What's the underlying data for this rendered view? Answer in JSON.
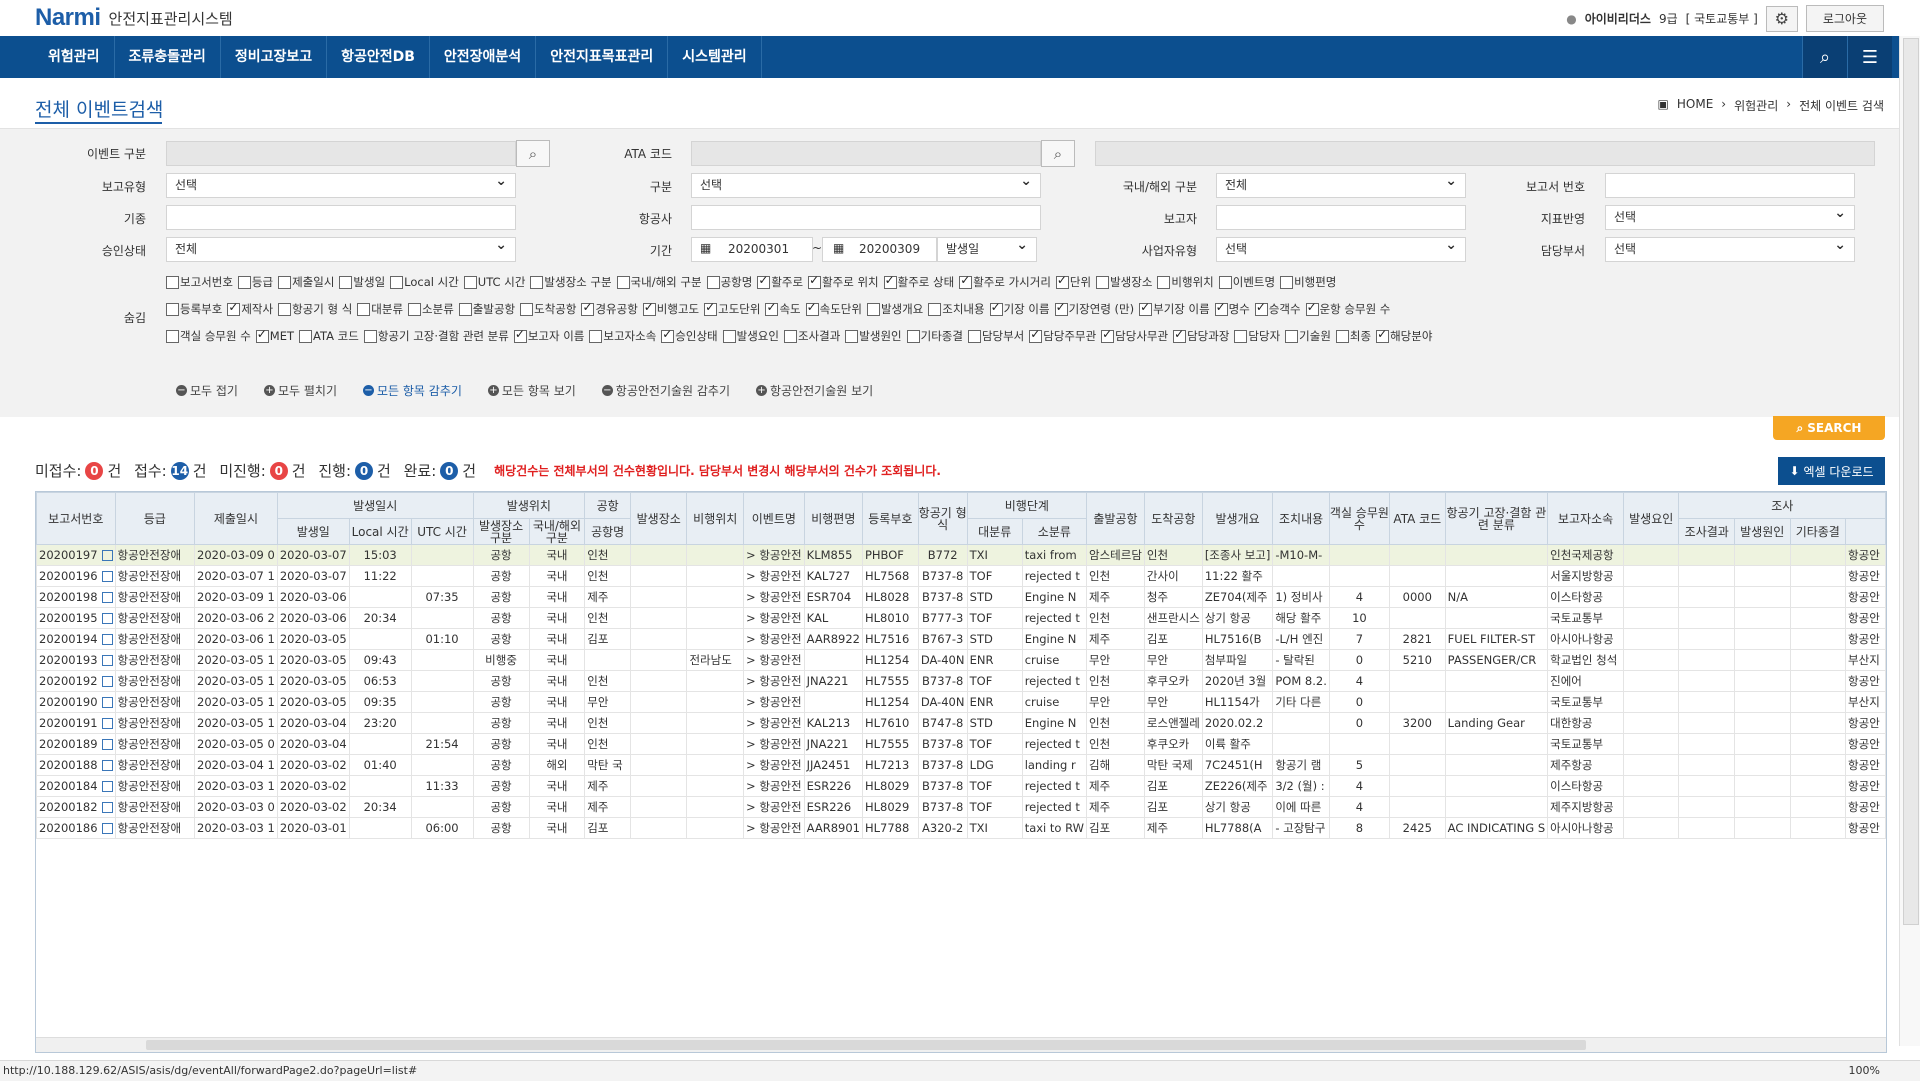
{
  "app": {
    "logo_main": "Narmi",
    "logo_accent": "",
    "system_name": "안전지표관리시스템",
    "user_name": "아이비리더스",
    "user_grade": "9급",
    "user_org": "[ 국토교통부 ]",
    "logout_label": "로그아웃"
  },
  "nav": [
    "위험관리",
    "조류충돌관리",
    "정비고장보고",
    "항공안전DB",
    "안전장애분석",
    "안전지표목표관리",
    "시스템관리"
  ],
  "page": {
    "title": "전체 이벤트검색",
    "breadcrumb": [
      "HOME",
      "위험관리",
      "전체 이벤트 검색"
    ]
  },
  "form": {
    "event_type_label": "이벤트 구분",
    "ata_label": "ATA 코드",
    "report_type_label": "보고유형",
    "report_type_value": "선택",
    "category_label": "구분",
    "category_value": "선택",
    "domestic_label": "국내/해외 구분",
    "domestic_value": "전체",
    "report_no_label": "보고서 번호",
    "aircraft_type_label": "기종",
    "airline_label": "항공사",
    "reporter_label": "보고자",
    "indicator_label": "지표반영",
    "indicator_value": "선택",
    "approval_label": "승인상태",
    "approval_value": "전체",
    "period_label": "기간",
    "period_from": "20200301",
    "period_tilde": "~",
    "period_to": "20200309",
    "period_type": "발생일",
    "cause_type_label": "사업자유형",
    "cause_type_value": "선택",
    "dept_label": "담당부서",
    "dept_value": "선택",
    "hide_label": "숨김"
  },
  "hide_rows": [
    [
      {
        "label": "보고서번호",
        "checked": false
      },
      {
        "label": "등급",
        "checked": false
      },
      {
        "label": "제출일시",
        "checked": false
      },
      {
        "label": "발생일",
        "checked": false
      },
      {
        "label": "Local 시간",
        "checked": false
      },
      {
        "label": "UTC 시간",
        "checked": false
      },
      {
        "label": "발생장소 구분",
        "checked": false
      },
      {
        "label": "국내/해외 구분",
        "checked": false
      },
      {
        "label": "공항명",
        "checked": false
      },
      {
        "label": "활주로",
        "checked": true
      },
      {
        "label": "활주로 위치",
        "checked": true
      },
      {
        "label": "활주로 상태",
        "checked": true
      },
      {
        "label": "활주로 가시거리",
        "checked": true
      },
      {
        "label": "단위",
        "checked": true
      },
      {
        "label": "발생장소",
        "checked": false
      },
      {
        "label": "비행위치",
        "checked": false
      },
      {
        "label": "이벤트명",
        "checked": false
      },
      {
        "label": "비행편명",
        "checked": false
      }
    ],
    [
      {
        "label": "등록부호",
        "checked": false
      },
      {
        "label": "제작사",
        "checked": true
      },
      {
        "label": "항공기 형 식",
        "checked": false
      },
      {
        "label": "대분류",
        "checked": false
      },
      {
        "label": "소분류",
        "checked": false
      },
      {
        "label": "출발공항",
        "checked": false
      },
      {
        "label": "도착공항",
        "checked": false
      },
      {
        "label": "경유공항",
        "checked": true
      },
      {
        "label": "비행고도",
        "checked": true
      },
      {
        "label": "고도단위",
        "checked": true
      },
      {
        "label": "속도",
        "checked": true
      },
      {
        "label": "속도단위",
        "checked": true
      },
      {
        "label": "발생개요",
        "checked": false
      },
      {
        "label": "조치내용",
        "checked": false
      },
      {
        "label": "기장 이름",
        "checked": true
      },
      {
        "label": "기장연령 (만)",
        "checked": true
      },
      {
        "label": "부기장 이름",
        "checked": true
      },
      {
        "label": "명수",
        "checked": true
      },
      {
        "label": "승객수",
        "checked": true
      },
      {
        "label": "운항 승무원 수",
        "checked": true
      }
    ],
    [
      {
        "label": "객실 승무원 수",
        "checked": false
      },
      {
        "label": "MET",
        "checked": true
      },
      {
        "label": "ATA 코드",
        "checked": false
      },
      {
        "label": "항공기 고장·결함 관련 분류",
        "checked": false
      },
      {
        "label": "보고자 이름",
        "checked": true
      },
      {
        "label": "보고자소속",
        "checked": false
      },
      {
        "label": "승인상태",
        "checked": true
      },
      {
        "label": "발생요인",
        "checked": false
      },
      {
        "label": "조사결과",
        "checked": false
      },
      {
        "label": "발생원인",
        "checked": false
      },
      {
        "label": "기타종결",
        "checked": false
      },
      {
        "label": "담당부서",
        "checked": false
      },
      {
        "label": "담당주무관",
        "checked": true
      },
      {
        "label": "담당사무관",
        "checked": true
      },
      {
        "label": "담당과장",
        "checked": true
      },
      {
        "label": "담당자",
        "checked": false
      },
      {
        "label": "기술원",
        "checked": false
      },
      {
        "label": "최종",
        "checked": false
      },
      {
        "label": "해당분야",
        "checked": true
      }
    ]
  ],
  "controls": [
    "모두 접기",
    "모두 펼치기",
    "모든 항목 감추기",
    "모든 항목 보기",
    "항공안전기술원 감추기",
    "항공안전기술원 보기"
  ],
  "search_label": "SEARCH",
  "summary": {
    "pending_label": "미접수:",
    "pending": "0",
    "unit": "건",
    "received_label": "접수:",
    "received": "14",
    "notdone_label": "미진행:",
    "notdone": "0",
    "progress_label": "진행:",
    "progress": "0",
    "done_label": "완료:",
    "done": "0",
    "notice": "해당건수는 전체부서의 건수현황입니다. 담당부서 변경시 해당부서의 건수가 조회됩니다."
  },
  "excel_label": "엑셀 다운로드",
  "table": {
    "groups": {
      "occur_datetime": "발생일시",
      "occur_pos": "발생위치",
      "airport": "공항",
      "flight_phase": "비행단계",
      "investigation": "조사"
    },
    "headers": {
      "report_no": "보고서번호",
      "grade": "등급",
      "submitted": "제출일시",
      "occur_date": "발생일",
      "local": "Local 시간",
      "utc": "UTC 시간",
      "pos_type": "발생장소 구분",
      "dom": "국내/해외 구분",
      "airport_name": "공항명",
      "place": "발생장소",
      "flight_pos": "비행위치",
      "event": "이벤트명",
      "flight_no": "비행편명",
      "reg": "등록부호",
      "ac_type": "항공기 형 식",
      "major": "대분류",
      "minor": "소분류",
      "dep": "출발공항",
      "arr": "도착공항",
      "summary": "발생개요",
      "action": "조치내용",
      "cabin": "객실 승무원 수",
      "ata": "ATA 코드",
      "defect": "항공기 고장·결함 관련 분류",
      "reporter_org": "보고자소속",
      "factor": "발생요인",
      "result": "조사결과",
      "cause": "발생원인",
      "other": "기타종결"
    },
    "rows": [
      [
        "20200197",
        "항공안전장애",
        "2020-03-09 0",
        "2020-03-07",
        "15:03",
        "",
        "공항",
        "국내",
        "인천",
        "",
        "",
        "> 항공안전",
        "KLM855",
        "PHBOF",
        "B772",
        "TXI",
        "taxi from",
        "암스테르담",
        "인천",
        "[조종사 보고]",
        "-M10-M-",
        "",
        "",
        "",
        "인천국제공항",
        "",
        "",
        "",
        "",
        "항공안"
      ],
      [
        "20200196",
        "항공안전장애",
        "2020-03-07 1",
        "2020-03-07",
        "11:22",
        "",
        "공항",
        "국내",
        "인천",
        "",
        "",
        "> 항공안전",
        "KAL727",
        "HL7568",
        "B737-8",
        "TOF",
        "rejected t",
        "인천",
        "간사이",
        "11:22 활주",
        "",
        "",
        "",
        "",
        "서울지방항공",
        "",
        "",
        "",
        "",
        "항공안"
      ],
      [
        "20200198",
        "항공안전장애",
        "2020-03-09 1",
        "2020-03-06",
        "",
        "07:35",
        "공항",
        "국내",
        "제주",
        "",
        "",
        "> 항공안전",
        "ESR704",
        "HL8028",
        "B737-8",
        "STD",
        "Engine N",
        "제주",
        "청주",
        "ZE704(제주",
        "1) 정비사",
        "4",
        "0000",
        "N/A",
        "이스타항공",
        "",
        "",
        "",
        "",
        "항공안"
      ],
      [
        "20200195",
        "항공안전장애",
        "2020-03-06 2",
        "2020-03-06",
        "20:34",
        "",
        "공항",
        "국내",
        "인천",
        "",
        "",
        "> 항공안전",
        "KAL",
        "HL8010",
        "B777-3",
        "TOF",
        "rejected t",
        "인천",
        "샌프란시스",
        "상기 항공",
        "해당 활주",
        "10",
        "",
        "",
        "국토교통부",
        "",
        "",
        "",
        "",
        "항공안"
      ],
      [
        "20200194",
        "항공안전장애",
        "2020-03-06 1",
        "2020-03-05",
        "",
        "01:10",
        "공항",
        "국내",
        "김포",
        "",
        "",
        "> 항공안전",
        "AAR8922",
        "HL7516",
        "B767-3",
        "STD",
        "Engine N",
        "제주",
        "김포",
        "HL7516(B",
        "-L/H 엔진",
        "7",
        "2821",
        "FUEL FILTER-ST",
        "아시아나항공",
        "",
        "",
        "",
        "",
        "항공안"
      ],
      [
        "20200193",
        "항공안전장애",
        "2020-03-05 1",
        "2020-03-05",
        "09:43",
        "",
        "비행중",
        "국내",
        "",
        "",
        "전라남도",
        "> 항공안전",
        "",
        "HL1254",
        "DA-40N",
        "ENR",
        "cruise",
        "무안",
        "무안",
        "첨부파일",
        "- 탈락된",
        "0",
        "5210",
        "PASSENGER/CR",
        "학교법인 청석",
        "",
        "",
        "",
        "",
        "부산지"
      ],
      [
        "20200192",
        "항공안전장애",
        "2020-03-05 1",
        "2020-03-05",
        "06:53",
        "",
        "공항",
        "국내",
        "인천",
        "",
        "",
        "> 항공안전",
        "JNA221",
        "HL7555",
        "B737-8",
        "TOF",
        "rejected t",
        "인천",
        "후쿠오카",
        "2020년 3월",
        "POM 8.2.",
        "4",
        "",
        "",
        "진에어",
        "",
        "",
        "",
        "",
        "항공안"
      ],
      [
        "20200190",
        "항공안전장애",
        "2020-03-05 1",
        "2020-03-05",
        "09:35",
        "",
        "공항",
        "국내",
        "무안",
        "",
        "",
        "> 항공안전",
        "",
        "HL1254",
        "DA-40N",
        "ENR",
        "cruise",
        "무안",
        "무안",
        "HL1154가",
        "기타 다른",
        "0",
        "",
        "",
        "국토교통부",
        "",
        "",
        "",
        "",
        "부산지"
      ],
      [
        "20200191",
        "항공안전장애",
        "2020-03-05 1",
        "2020-03-04",
        "23:20",
        "",
        "공항",
        "국내",
        "인천",
        "",
        "",
        "> 항공안전",
        "KAL213",
        "HL7610",
        "B747-8",
        "STD",
        "Engine N",
        "인천",
        "로스앤젤레",
        "2020.02.2",
        "",
        "0",
        "3200",
        "Landing Gear",
        "대한항공",
        "",
        "",
        "",
        "",
        "항공안"
      ],
      [
        "20200189",
        "항공안전장애",
        "2020-03-05 0",
        "2020-03-04",
        "",
        "21:54",
        "공항",
        "국내",
        "인천",
        "",
        "",
        "> 항공안전",
        "JNA221",
        "HL7555",
        "B737-8",
        "TOF",
        "rejected t",
        "인천",
        "후쿠오카",
        "이륙 활주",
        "",
        "",
        "",
        "",
        "국토교통부",
        "",
        "",
        "",
        "",
        "항공안"
      ],
      [
        "20200188",
        "항공안전장애",
        "2020-03-04 1",
        "2020-03-02",
        "01:40",
        "",
        "공항",
        "해외",
        "막탄 국",
        "",
        "",
        "> 항공안전",
        "JJA2451",
        "HL7213",
        "B737-8",
        "LDG",
        "landing r",
        "김해",
        "막탄 국제",
        "7C2451(H",
        "항공기 램",
        "5",
        "",
        "",
        "제주항공",
        "",
        "",
        "",
        "",
        "항공안"
      ],
      [
        "20200184",
        "항공안전장애",
        "2020-03-03 1",
        "2020-03-02",
        "",
        "11:33",
        "공항",
        "국내",
        "제주",
        "",
        "",
        "> 항공안전",
        "ESR226",
        "HL8029",
        "B737-8",
        "TOF",
        "rejected t",
        "제주",
        "김포",
        "ZE226(제주",
        "3/2 (월) :",
        "4",
        "",
        "",
        "이스타항공",
        "",
        "",
        "",
        "",
        "항공안"
      ],
      [
        "20200182",
        "항공안전장애",
        "2020-03-03 0",
        "2020-03-02",
        "20:34",
        "",
        "공항",
        "국내",
        "제주",
        "",
        "",
        "> 항공안전",
        "ESR226",
        "HL8029",
        "B737-8",
        "TOF",
        "rejected t",
        "제주",
        "김포",
        "상기 항공",
        "이에 따른",
        "4",
        "",
        "",
        "제주지방항공",
        "",
        "",
        "",
        "",
        "항공안"
      ],
      [
        "20200186",
        "항공안전장애",
        "2020-03-03 1",
        "2020-03-01",
        "",
        "06:00",
        "공항",
        "국내",
        "김포",
        "",
        "",
        "> 항공안전",
        "AAR8901",
        "HL7788",
        "A320-2",
        "TXI",
        "taxi to RW",
        "김포",
        "제주",
        "HL7788(A",
        "- 고장탐구",
        "8",
        "2425",
        "AC INDICATING S",
        "아시아나항공",
        "",
        "",
        "",
        "",
        "항공안"
      ]
    ]
  },
  "status_url": "http://10.188.129.62/ASIS/asis/dg/eventAll/forwardPage2.do?pageUrl=list#",
  "zoom": "100%",
  "icons": {
    "user": "user-icon",
    "gear": "gear-icon",
    "search": "search-icon",
    "menu": "menu-icon",
    "home": "home-icon",
    "calendar": "calendar-icon",
    "download": "download-icon",
    "doc": "document-icon"
  }
}
